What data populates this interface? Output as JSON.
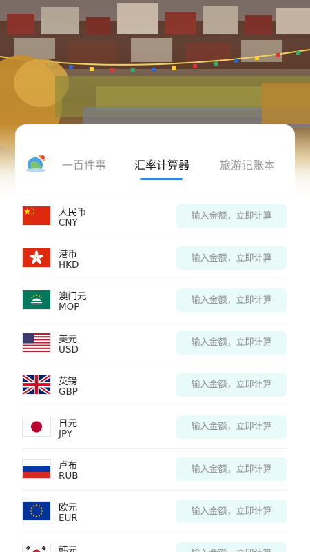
{
  "tabs": [
    {
      "label": "一百件事",
      "active": false
    },
    {
      "label": "汇率计算器",
      "active": true
    },
    {
      "label": "旅游记账本",
      "active": false
    }
  ],
  "accent_color": "#2f86e8",
  "input_bg_color": "#e9fafa",
  "amount_placeholder": "输入金额，立即计算",
  "currencies": [
    {
      "name": "人民币",
      "code": "CNY",
      "flag": "china-flag-icon"
    },
    {
      "name": "港币",
      "code": "HKD",
      "flag": "hong-kong-flag-icon"
    },
    {
      "name": "澳门元",
      "code": "MOP",
      "flag": "macau-flag-icon"
    },
    {
      "name": "美元",
      "code": "USD",
      "flag": "usa-flag-icon"
    },
    {
      "name": "英镑",
      "code": "GBP",
      "flag": "uk-flag-icon"
    },
    {
      "name": "日元",
      "code": "JPY",
      "flag": "japan-flag-icon"
    },
    {
      "name": "卢布",
      "code": "RUB",
      "flag": "russia-flag-icon"
    },
    {
      "name": "欧元",
      "code": "EUR",
      "flag": "eu-flag-icon"
    },
    {
      "name": "韩元",
      "code": "",
      "flag": "korea-flag-icon"
    }
  ]
}
